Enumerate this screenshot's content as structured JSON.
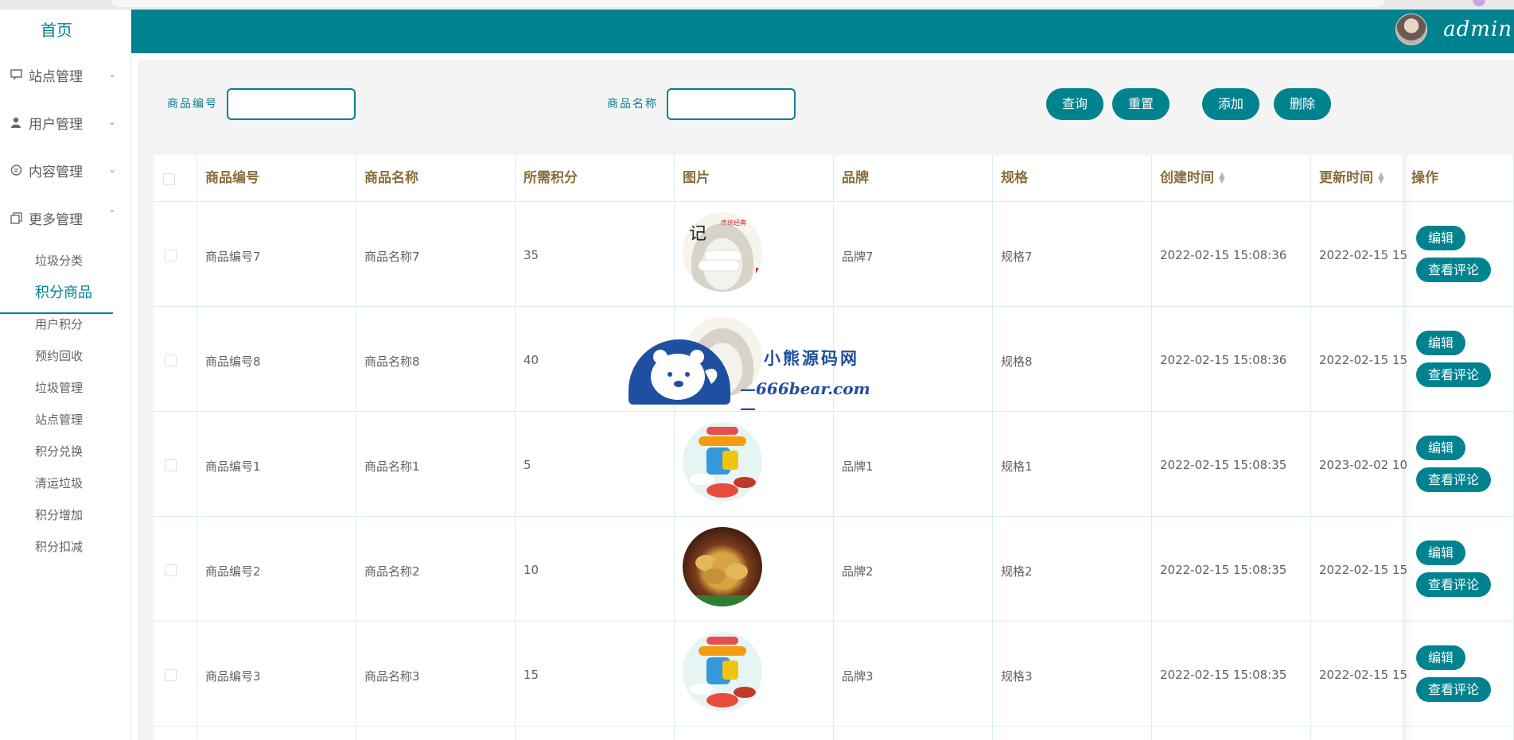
{
  "header": {
    "username": "admin"
  },
  "sidebar": {
    "home": "首页",
    "menus": [
      {
        "label": "站点管理",
        "icon": "monitor-icon",
        "expanded": false
      },
      {
        "label": "用户管理",
        "icon": "user-icon",
        "expanded": false
      },
      {
        "label": "内容管理",
        "icon": "chat-icon",
        "expanded": false
      },
      {
        "label": "更多管理",
        "icon": "copy-icon",
        "expanded": true
      }
    ],
    "submenu": [
      {
        "label": "垃圾分类",
        "active": false
      },
      {
        "label": "积分商品",
        "active": true
      },
      {
        "label": "用户积分",
        "active": false
      },
      {
        "label": "预约回收",
        "active": false
      },
      {
        "label": "垃圾管理",
        "active": false
      },
      {
        "label": "站点管理",
        "active": false
      },
      {
        "label": "积分兑换",
        "active": false
      },
      {
        "label": "清运垃圾",
        "active": false
      },
      {
        "label": "积分增加",
        "active": false
      },
      {
        "label": "积分扣减",
        "active": false
      }
    ]
  },
  "search": {
    "code_label": "商品编号",
    "code_value": "",
    "name_label": "商品名称",
    "name_value": "",
    "query_button": "查询",
    "reset_button": "重置",
    "add_button": "添加",
    "delete_button": "删除"
  },
  "table": {
    "headers": {
      "code": "商品编号",
      "name": "商品名称",
      "points": "所需积分",
      "image": "图片",
      "brand": "品牌",
      "spec": "规格",
      "created": "创建时间",
      "updated": "更新时间",
      "actions": "操作"
    },
    "rows": [
      {
        "code": "商品编号7",
        "name": "商品名称7",
        "points": "35",
        "brand": "品牌7",
        "spec": "规格7",
        "created": "2022-02-15 15:08:36",
        "updated": "2022-02-15 15",
        "image": "rice-cake"
      },
      {
        "code": "商品编号8",
        "name": "商品名称8",
        "points": "40",
        "brand": "",
        "spec": "规格8",
        "created": "2022-02-15 15:08:36",
        "updated": "2022-02-15 15",
        "image": "rice-cake"
      },
      {
        "code": "商品编号1",
        "name": "商品名称1",
        "points": "5",
        "brand": "品牌1",
        "spec": "规格1",
        "created": "2022-02-15 15:08:35",
        "updated": "2023-02-02 10",
        "image": "toy-machine"
      },
      {
        "code": "商品编号2",
        "name": "商品名称2",
        "points": "10",
        "brand": "品牌2",
        "spec": "规格2",
        "created": "2022-02-15 15:08:35",
        "updated": "2022-02-15 15",
        "image": "pastry"
      },
      {
        "code": "商品编号3",
        "name": "商品名称3",
        "points": "15",
        "brand": "品牌3",
        "spec": "规格3",
        "created": "2022-02-15 15:08:35",
        "updated": "2022-02-15 15",
        "image": "toy-machine"
      }
    ],
    "edit_button": "编辑",
    "comment_button": "查看评论"
  },
  "watermark": {
    "title": "小熊源码网",
    "url": "—666bear.com—"
  },
  "colors": {
    "primary": "#00838f",
    "header_text": "#8a6d3b",
    "border": "#d8eef4"
  }
}
